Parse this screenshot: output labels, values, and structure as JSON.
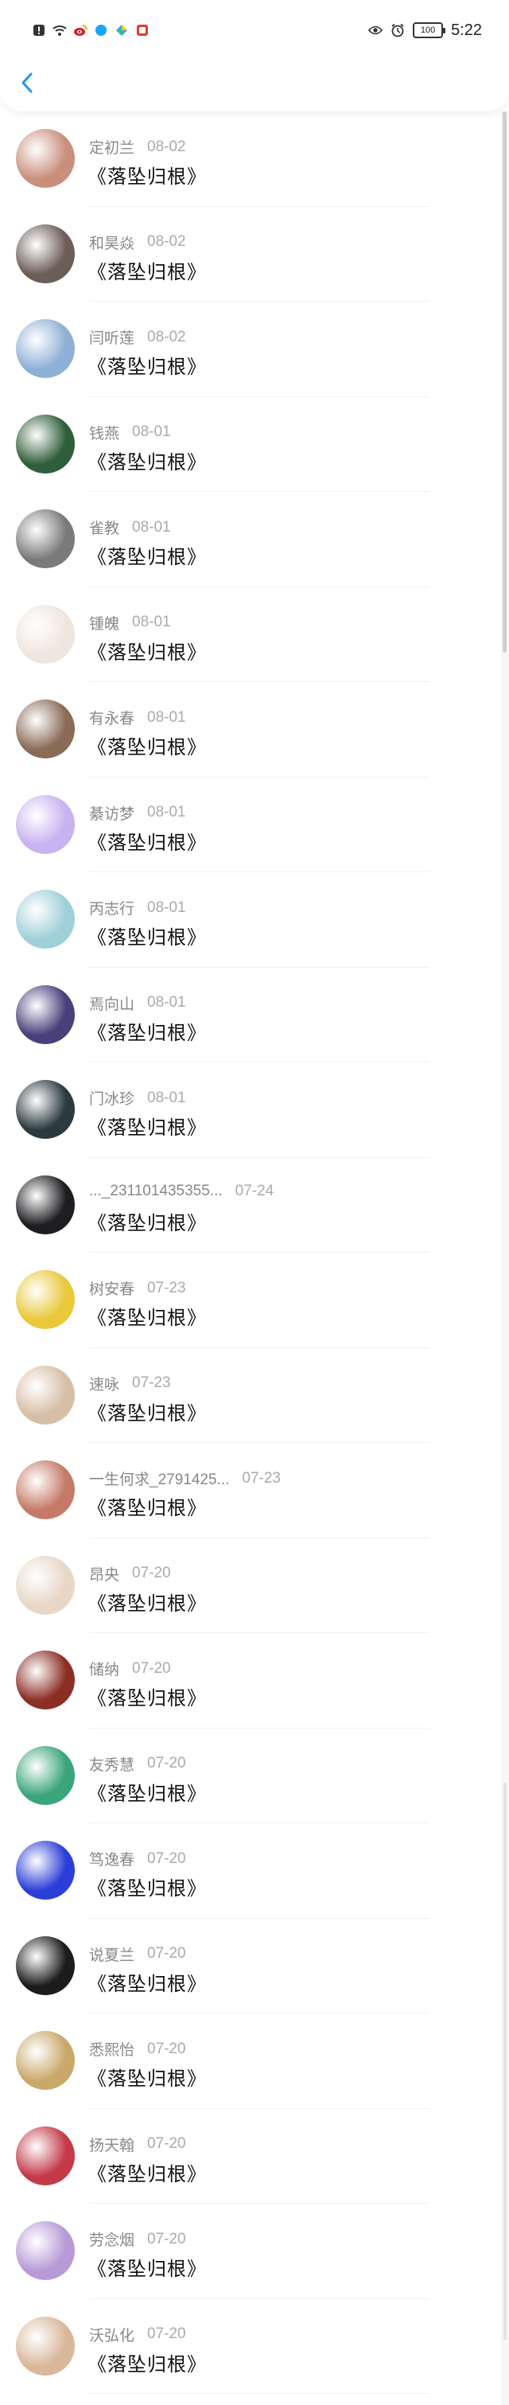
{
  "status_bar": {
    "time": "5:22",
    "battery": "100"
  },
  "header": {
    "back_icon": "chevron-left-icon",
    "accent": "#2196f3"
  },
  "comments": [
    {
      "name": "定初兰",
      "time": "08-02",
      "text": "《落坠归根》",
      "avatar_color": "#c98f7c"
    },
    {
      "name": "和昊焱",
      "time": "08-02",
      "text": "《落坠归根》",
      "avatar_color": "#6b5d57"
    },
    {
      "name": "闫听莲",
      "time": "08-02",
      "text": "《落坠归根》",
      "avatar_color": "#8fb0d6"
    },
    {
      "name": "钱燕",
      "time": "08-01",
      "text": "《落坠归根》",
      "avatar_color": "#2f5e3a"
    },
    {
      "name": "雀教",
      "time": "08-01",
      "text": "《落坠归根》",
      "avatar_color": "#7a7a7a"
    },
    {
      "name": "锺魄",
      "time": "08-01",
      "text": "《落坠归根》",
      "avatar_color": "#efe6df"
    },
    {
      "name": "有永春",
      "time": "08-01",
      "text": "《落坠归根》",
      "avatar_color": "#8a6b56"
    },
    {
      "name": "綦访梦",
      "time": "08-01",
      "text": "《落坠归根》",
      "avatar_color": "#c8b2f0"
    },
    {
      "name": "丙志行",
      "time": "08-01",
      "text": "《落坠归根》",
      "avatar_color": "#9fd0d8"
    },
    {
      "name": "焉向山",
      "time": "08-01",
      "text": "《落坠归根》",
      "avatar_color": "#4a3f7a"
    },
    {
      "name": "门冰珍",
      "time": "08-01",
      "text": "《落坠归根》",
      "avatar_color": "#2c3a3f"
    },
    {
      "name": "..._231101435355...",
      "time": "07-24",
      "text": "《落坠归根》",
      "avatar_color": "#1e1e22"
    },
    {
      "name": "树安春",
      "time": "07-23",
      "text": "《落坠归根》",
      "avatar_color": "#e9c83a"
    },
    {
      "name": "速咏",
      "time": "07-23",
      "text": "《落坠归根》",
      "avatar_color": "#d6bfa6"
    },
    {
      "name": "一生何求_2791425...",
      "time": "07-23",
      "text": "《落坠归根》",
      "avatar_color": "#c57a67"
    },
    {
      "name": "昂央",
      "time": "07-20",
      "text": "《落坠归根》",
      "avatar_color": "#e8d7c7"
    },
    {
      "name": "储纳",
      "time": "07-20",
      "text": "《落坠归根》",
      "avatar_color": "#8b2f25"
    },
    {
      "name": "友秀慧",
      "time": "07-20",
      "text": "《落坠归根》",
      "avatar_color": "#3aa57a"
    },
    {
      "name": "笃逸春",
      "time": "07-20",
      "text": "《落坠归根》",
      "avatar_color": "#2b3fd8"
    },
    {
      "name": "说夏兰",
      "time": "07-20",
      "text": "《落坠归根》",
      "avatar_color": "#1c1c1c"
    },
    {
      "name": "悉熙怡",
      "time": "07-20",
      "text": "《落坠归根》",
      "avatar_color": "#c9a86a"
    },
    {
      "name": "扬天翰",
      "time": "07-20",
      "text": "《落坠归根》",
      "avatar_color": "#c53a4a"
    },
    {
      "name": "劳念烟",
      "time": "07-20",
      "text": "《落坠归根》",
      "avatar_color": "#b89ad6"
    },
    {
      "name": "沃弘化",
      "time": "07-20",
      "text": "《落坠归根》",
      "avatar_color": "#d9b79a"
    }
  ]
}
